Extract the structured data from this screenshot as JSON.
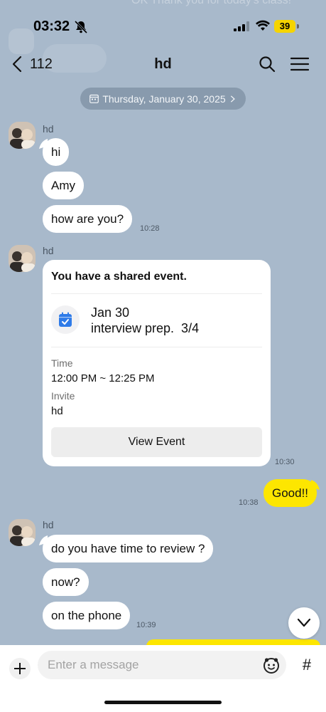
{
  "status": {
    "time": "03:32",
    "battery": "39"
  },
  "header": {
    "back_count": "112",
    "title": "hd"
  },
  "date_divider": "Thursday, January 30, 2025",
  "background_ghost": "OK Thank you for today's class!",
  "groups": [
    {
      "sender": "hd",
      "messages": [
        "hi",
        "Amy",
        "how are you?"
      ],
      "time": "10:28"
    },
    {
      "sender": "hd",
      "time": "10:30"
    },
    {
      "sender": "hd",
      "messages": [
        "do you have time to review ?",
        "now?",
        "on the phone"
      ],
      "time": "10:39"
    }
  ],
  "event": {
    "heading": "You have a shared event.",
    "date": "Jan 30",
    "name": "interview prep.  3/4",
    "time_label": "Time",
    "time_value": "12:00 PM ~ 12:25 PM",
    "invite_label": "Invite",
    "invite_value": "hd",
    "button": "View Event"
  },
  "my_message": {
    "text": "Good!!",
    "time": "10:38"
  },
  "input": {
    "placeholder": "Enter a message"
  },
  "colors": {
    "chat_bg": "#a8b9cb",
    "my_bubble": "#fde600",
    "battery": "#f5d400"
  }
}
